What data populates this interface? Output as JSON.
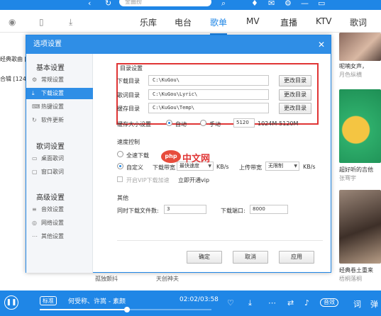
{
  "topbar": {
    "search_placeholder": "金曲捞",
    "icons": [
      "back-icon",
      "refresh-icon",
      "search-icon",
      "shirt-icon",
      "mail-icon",
      "settings-icon",
      "minimize-icon",
      "maximize-icon"
    ]
  },
  "nav": {
    "tabs": [
      {
        "label": "乐库"
      },
      {
        "label": "电台"
      },
      {
        "label": "歌单",
        "active": true
      },
      {
        "label": "MV"
      },
      {
        "label": "直播"
      },
      {
        "label": "KTV"
      },
      {
        "label": "歌词"
      }
    ]
  },
  "left": {
    "items": [
      "经典歌曲 [20",
      "合辑 [124"
    ]
  },
  "right": {
    "items": [
      {
        "title": "呢喃女声，",
        "sub": "月色纵横"
      },
      {
        "title": "超好听的吉他",
        "sub": "张骞宇"
      },
      {
        "title": "经典卷土重来",
        "sub": "梧桐落桐"
      }
    ]
  },
  "bg_row": {
    "left": "孤独颤抖",
    "right": "天创神夫"
  },
  "player": {
    "quality": "标准",
    "song": "何受称、许嵩 - 素颜",
    "time": "02:02/03:58",
    "progress": 0.51,
    "effect": "音效",
    "lyric": "词",
    "danmu": "弹"
  },
  "dialog": {
    "title": "选项设置",
    "sidebar": {
      "groups": [
        {
          "title": "基本设置",
          "items": [
            "常规设置",
            "下载设置",
            "热键设置",
            "软件更新"
          ]
        },
        {
          "title": "歌词设置",
          "items": [
            "桌面歌词",
            "窗口歌词"
          ]
        },
        {
          "title": "高级设置",
          "items": [
            "音效设置",
            "网络设置",
            "其他设置"
          ]
        }
      ],
      "active": "下载设置"
    },
    "dirs": {
      "title": "目录设置",
      "rows": [
        {
          "label": "下载目录",
          "path": "C:\\KuGou\\",
          "button": "更改目录"
        },
        {
          "label": "歌词目录",
          "path": "C:\\KuGou\\Lyric\\",
          "button": "更改目录"
        },
        {
          "label": "缓存目录",
          "path": "C:\\KuGou\\Temp\\",
          "button": "更改目录"
        }
      ]
    },
    "cache": {
      "label": "缓存大小设置",
      "auto": "自动",
      "manual": "手动",
      "value": "5120",
      "range": "1024M-5120M"
    },
    "speed": {
      "title": "速度控制",
      "full": "全速下载",
      "custom": "自定义",
      "dl_label": "下载带宽",
      "dl_value": "最快速度",
      "unit": "KB/s",
      "ul_label": "上传带宽",
      "ul_value": "无限制",
      "vip_check": "开启VIP下载加速",
      "vip_link": "立即开通vip"
    },
    "other": {
      "title": "其他",
      "tasks_label": "同时下载文件数:",
      "tasks_value": "3",
      "port_label": "下载端口:",
      "port_value": "8000"
    },
    "buttons": {
      "ok": "确定",
      "cancel": "取消",
      "apply": "应用"
    }
  },
  "watermark": {
    "logo": "php",
    "text": "中文网"
  },
  "colors": {
    "accent": "#1f86e6",
    "highlight": "#e03535"
  }
}
